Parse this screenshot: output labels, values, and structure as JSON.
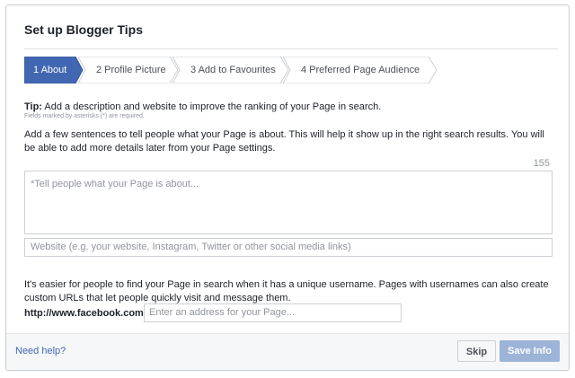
{
  "dialog": {
    "title": "Set up Blogger Tips"
  },
  "steps": [
    {
      "label": "1 About",
      "active": true
    },
    {
      "label": "2 Profile Picture",
      "active": false
    },
    {
      "label": "3 Add to Favourites",
      "active": false
    },
    {
      "label": "4 Preferred Page Audience",
      "active": false
    }
  ],
  "tip": {
    "prefix": "Tip:",
    "text": " Add a description and website to improve the ranking of your Page in search.",
    "required_note": "Fields marked by asterisks (*) are required."
  },
  "about": {
    "instructions": "Add a few sentences to tell people what your Page is about. This will help it show up in the right search results. You will be able to add more details later from your Page settings.",
    "char_count": "155",
    "placeholder": "*Tell people what your Page is about..."
  },
  "website": {
    "placeholder": "Website (e.g. your website, Instagram, Twitter or other  social media links)"
  },
  "username": {
    "text": "It's easier for people to find your Page in search when it has a unique username. Pages with usernames can also create custom URLs that let people quickly visit and message them.",
    "url_prefix": "http://www.facebook.com/",
    "placeholder": "Enter an address for your Page..."
  },
  "footer": {
    "help_link": "Need help?",
    "skip_label": "Skip",
    "save_label": "Save Info"
  },
  "colors": {
    "accent": "#4267b2",
    "active_step": "#4267b2",
    "disabled_button": "#9cb4d8"
  }
}
